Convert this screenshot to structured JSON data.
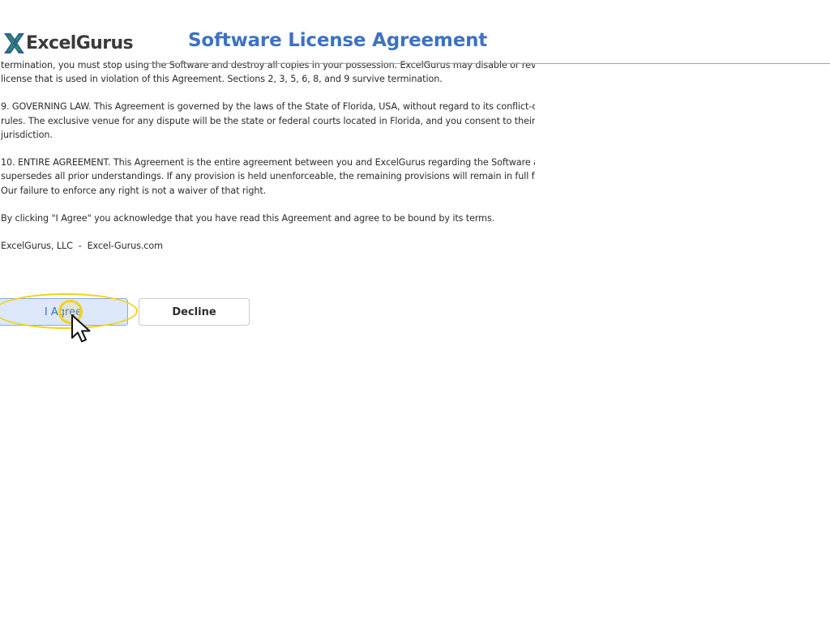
{
  "header": {
    "logo_text": "ExcelGurus",
    "title": "Software License Agreement"
  },
  "agreement": {
    "section8_line1": "termination, you must stop using the Software and destroy all copies in your possession. ExcelGurus may disable or revoke a",
    "section8_line2": "license that is used in violation of this Agreement. Sections 2, 3, 5, 6, 8, and 9 survive termination.",
    "section9_line1": "9. GOVERNING LAW. This Agreement is governed by the laws of the State of Florida, USA, without regard to its conflict-of-laws",
    "section9_line2": "rules. The exclusive venue for any dispute will be the state or federal courts located in Florida, and you consent to their",
    "section9_line3": "jurisdiction.",
    "section10_line1": "10. ENTIRE AGREEMENT. This Agreement is the entire agreement between you and ExcelGurus regarding the Software and",
    "section10_line2": "supersedes all prior understandings. If any provision is held unenforceable, the remaining provisions will remain in full force.",
    "section10_line3": "Our failure to enforce any right is not a waiver of that right.",
    "acknowledgement": "By clicking \"I Agree\" you acknowledge that you have read this Agreement and agree to be bound by its terms.",
    "footer": "ExcelGurus, LLC  -  Excel-Gurus.com"
  },
  "buttons": {
    "agree_label": "I Agree",
    "decline_label": "Decline"
  },
  "colors": {
    "brand_green": "#2e8b57",
    "brand_blue": "#2f5f9e",
    "title_blue": "#3d72c2",
    "highlight_yellow": "#f2d21a"
  },
  "icons": {
    "logo": "excelgurus-x-logo-icon",
    "cursor": "mouse-pointer-icon"
  }
}
